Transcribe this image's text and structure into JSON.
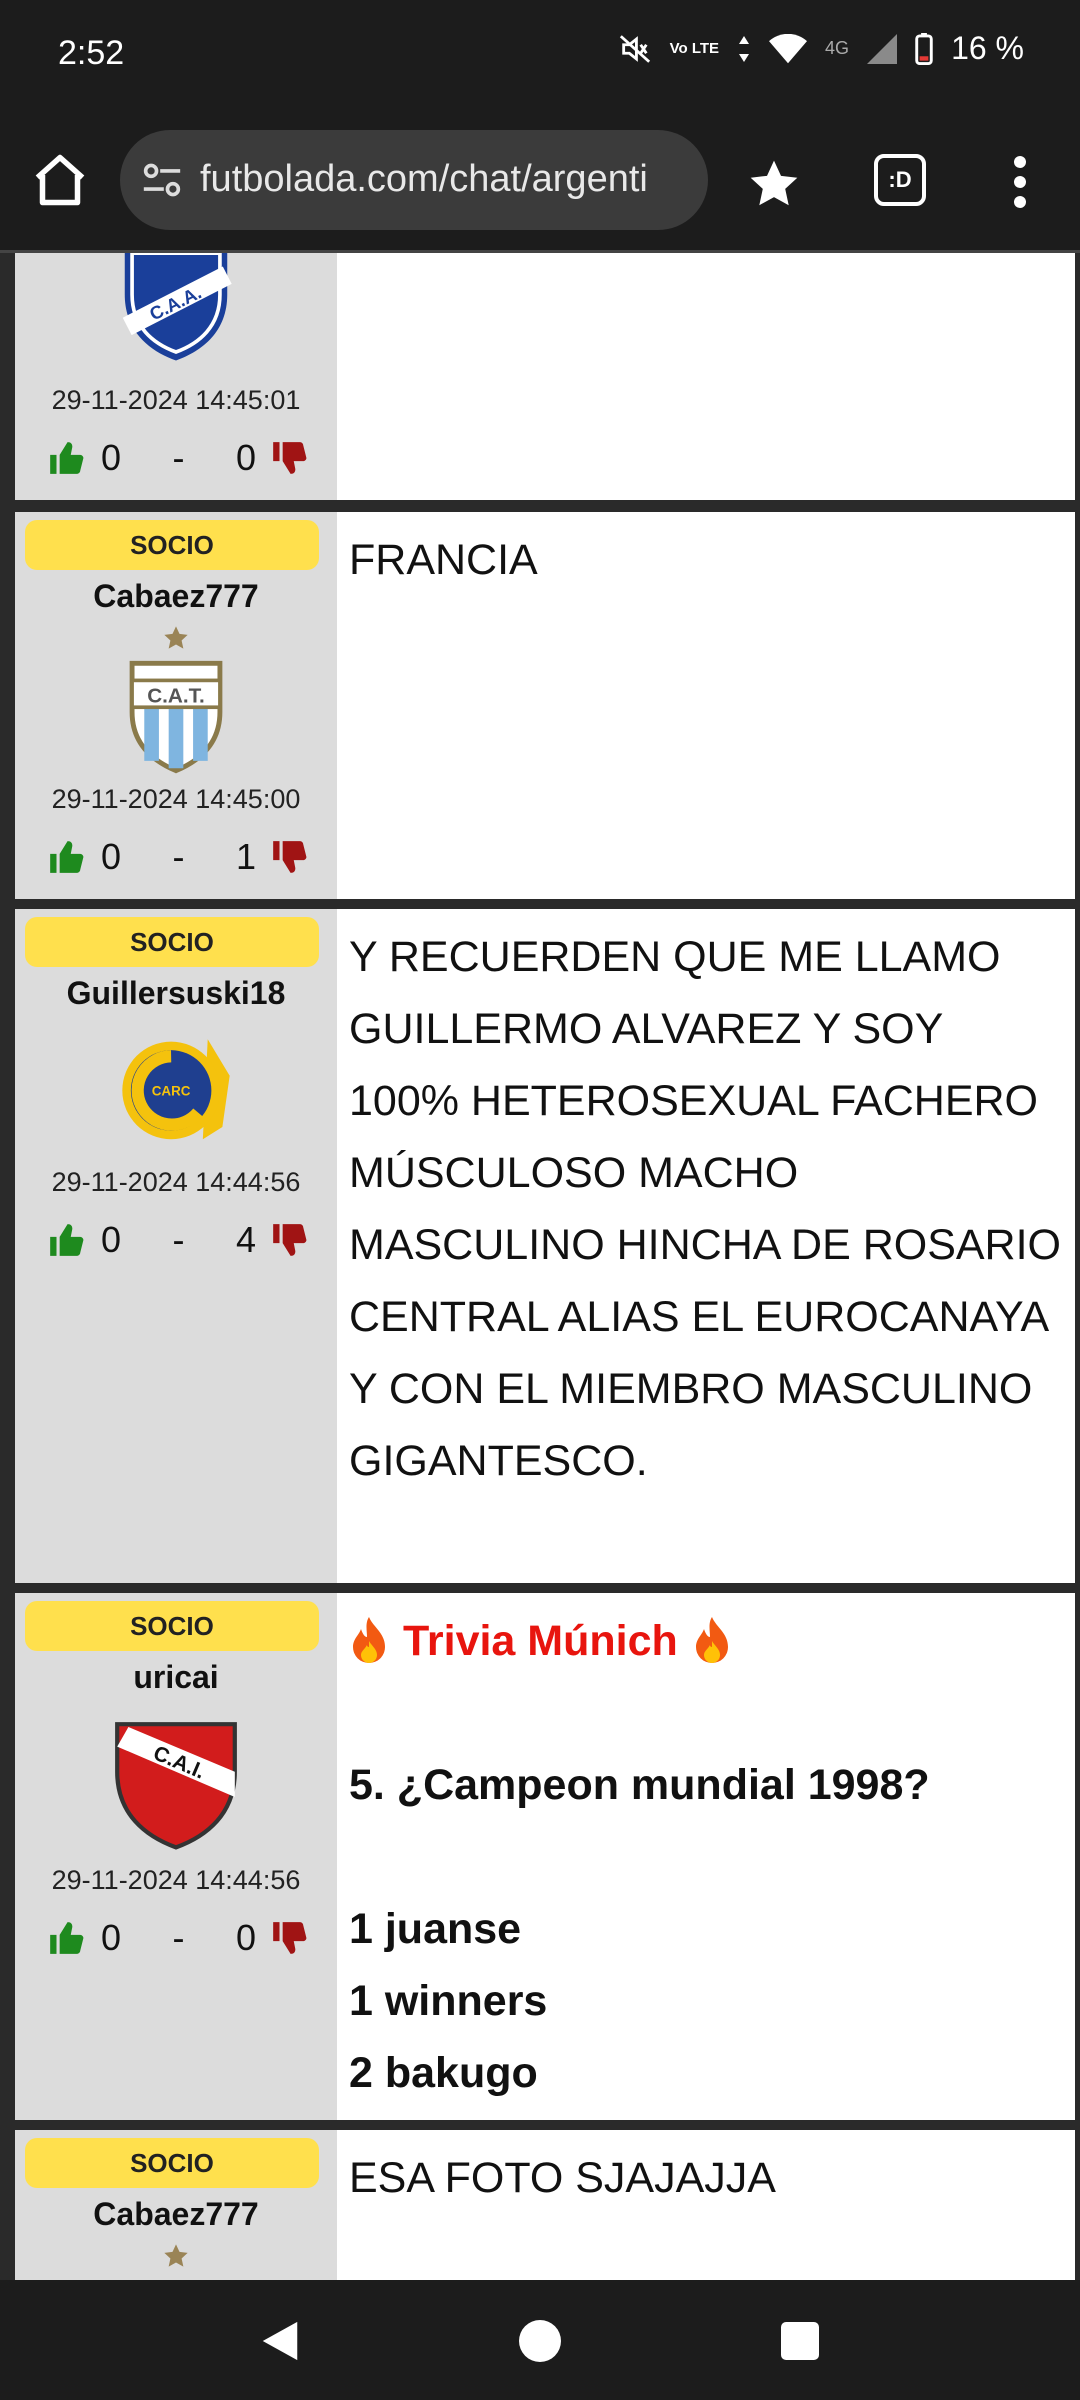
{
  "status": {
    "time": "2:52",
    "volte": "Vo LTE",
    "network": "4G",
    "battery": "16 %"
  },
  "browser": {
    "url": "futbolada.com/chat/argenti",
    "tab_label": ":D"
  },
  "posts": [
    {
      "timestamp": "29-11-2024 14:45:01",
      "likes": "0",
      "dash": "-",
      "dislikes": "0",
      "crest": "C.A.A."
    },
    {
      "badge": "SOCIO",
      "username": "Cabaez777",
      "crest": "C.A.T.",
      "timestamp": "29-11-2024 14:45:00",
      "likes": "0",
      "dash": "-",
      "dislikes": "1",
      "message": "FRANCIA"
    },
    {
      "badge": "SOCIO",
      "username": "Guillersuski18",
      "crest": "CARC",
      "timestamp": "29-11-2024 14:44:56",
      "likes": "0",
      "dash": "-",
      "dislikes": "4",
      "message": "Y RECUERDEN QUE ME LLAMO GUILLERMO ALVAREZ Y SOY 100% HETEROSEXUAL FACHERO MÚSCULOSO MACHO MASCULINO HINCHA DE ROSARIO CENTRAL ALIAS EL EUROCANAYA Y CON EL MIEMBRO MASCULINO GIGANTESCO."
    },
    {
      "badge": "SOCIO",
      "username": "uricai",
      "crest": "C.A.I.",
      "timestamp": "29-11-2024 14:44:56",
      "likes": "0",
      "dash": "-",
      "dislikes": "0",
      "trivia_title": "Trivia Múnich",
      "question": "5. ¿Campeon mundial 1998?",
      "scores": [
        "1 juanse",
        "1 winners",
        "2 bakugo"
      ]
    },
    {
      "badge": "SOCIO",
      "username": "Cabaez777",
      "message": "ESA FOTO SJAJAJJA"
    }
  ],
  "colors": {
    "socio_badge": "#ffe04d",
    "trivia_red": "#e8150e",
    "thumb_up": "#1e8a1e",
    "thumb_down": "#a01414",
    "left_panel": "#dcdcdc"
  }
}
